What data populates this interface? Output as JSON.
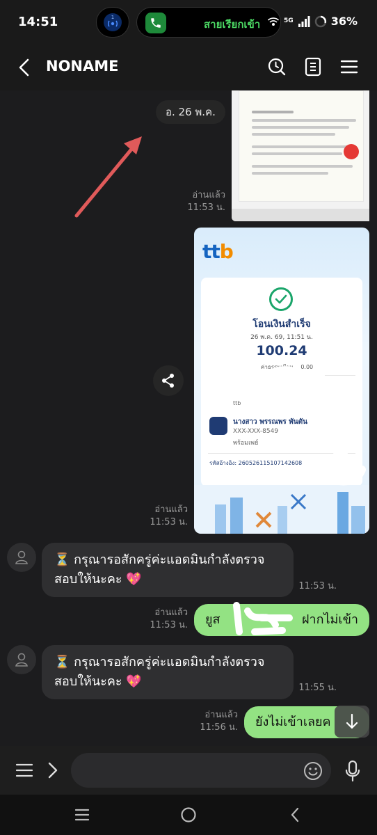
{
  "status_bar": {
    "time": "14:51",
    "notification_badge": "1",
    "call_status": "สายเรียกเข้า",
    "network": "5G",
    "battery": "36%"
  },
  "header": {
    "title": "NONAME"
  },
  "chat": {
    "date_chip": "อ. 26 พ.ค.",
    "messages": [
      {
        "read": "อ่านแล้ว",
        "time": "11:53 น."
      },
      {
        "read": "อ่านแล้ว",
        "time": "11:53 น.",
        "receipt": {
          "bank_logo": "ttb",
          "title": "โอนเงินสำเร็จ",
          "datetime": "26 พ.ค. 69, 11:51 น.",
          "amount": "100.24",
          "fee_label": "ค่าธรรมเนียม",
          "fee": "0.00",
          "sender_bank": "ttb",
          "recipient_name": "นางสาว พรรณพร พันตัน",
          "recipient_account": "XXX-XXX-8549",
          "recipient_method": "พร้อมเพย์",
          "reference": "รหัสอ้างอิง: 26052611510714260​8"
        }
      },
      {
        "text": "⏳ กรุณารอสักครู่ค่ะแอดมินกำลังตรวจสอบให้นะคะ 💖",
        "time": "11:53 น."
      },
      {
        "read": "อ่านแล้ว",
        "time": "11:53 น.",
        "text": "ยูส",
        "text_end": "ฝากไม่เข้า"
      },
      {
        "text": "⏳ กรุณารอสักครู่ค่ะแอดมินกำลังตรวจสอบให้นะคะ 💖",
        "time": "11:55 น."
      },
      {
        "read": "อ่านแล้ว",
        "time": "11:56 น.",
        "text": "ยังไม่เข้าเลยค"
      }
    ]
  },
  "input": {
    "placeholder": ""
  },
  "colors": {
    "outgoing_bubble": "#93e283",
    "incoming_bubble": "#2f2f31",
    "annotation_arrow": "#e05a5a"
  }
}
